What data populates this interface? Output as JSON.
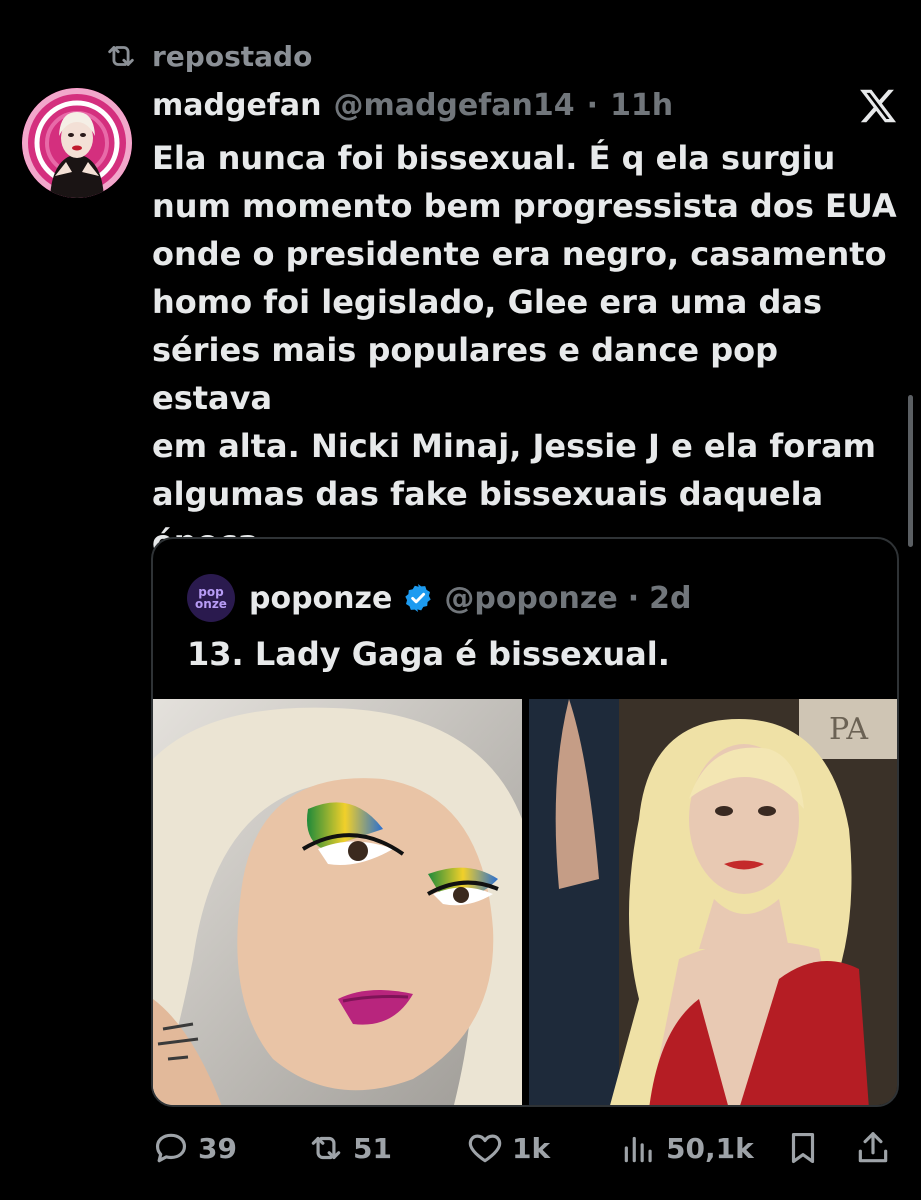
{
  "repost": {
    "label": "repostado",
    "icon": "repost-icon"
  },
  "tweet": {
    "display_name": "madgefan",
    "handle": "@madgefan14",
    "separator": "·",
    "time": "11h",
    "lines": [
      "Ela nunca foi bissexual. É q ela surgiu",
      "num momento bem progressista dos EUA",
      "onde o presidente era negro, casamento",
      "homo foi legislado, Glee era uma das",
      "séries mais populares e dance pop estava",
      "em alta. Nicki Minaj, Jessie J e ela foram",
      "algumas das fake bissexuais daquela",
      "época"
    ]
  },
  "quote": {
    "avatar_text_top": "pop",
    "avatar_text_bottom": "onze",
    "display_name": "poponze",
    "handle": "@poponze",
    "separator": "·",
    "time": "2d",
    "text": "13. Lady Gaga é bissexual."
  },
  "actions": {
    "replies": "39",
    "reposts": "51",
    "likes": "1k",
    "views": "50,1k"
  },
  "colors": {
    "background": "#000000",
    "text": "#e7e9ea",
    "muted": "#71767b",
    "verified": "#1d9bf0",
    "card_border": "#2f3336"
  }
}
